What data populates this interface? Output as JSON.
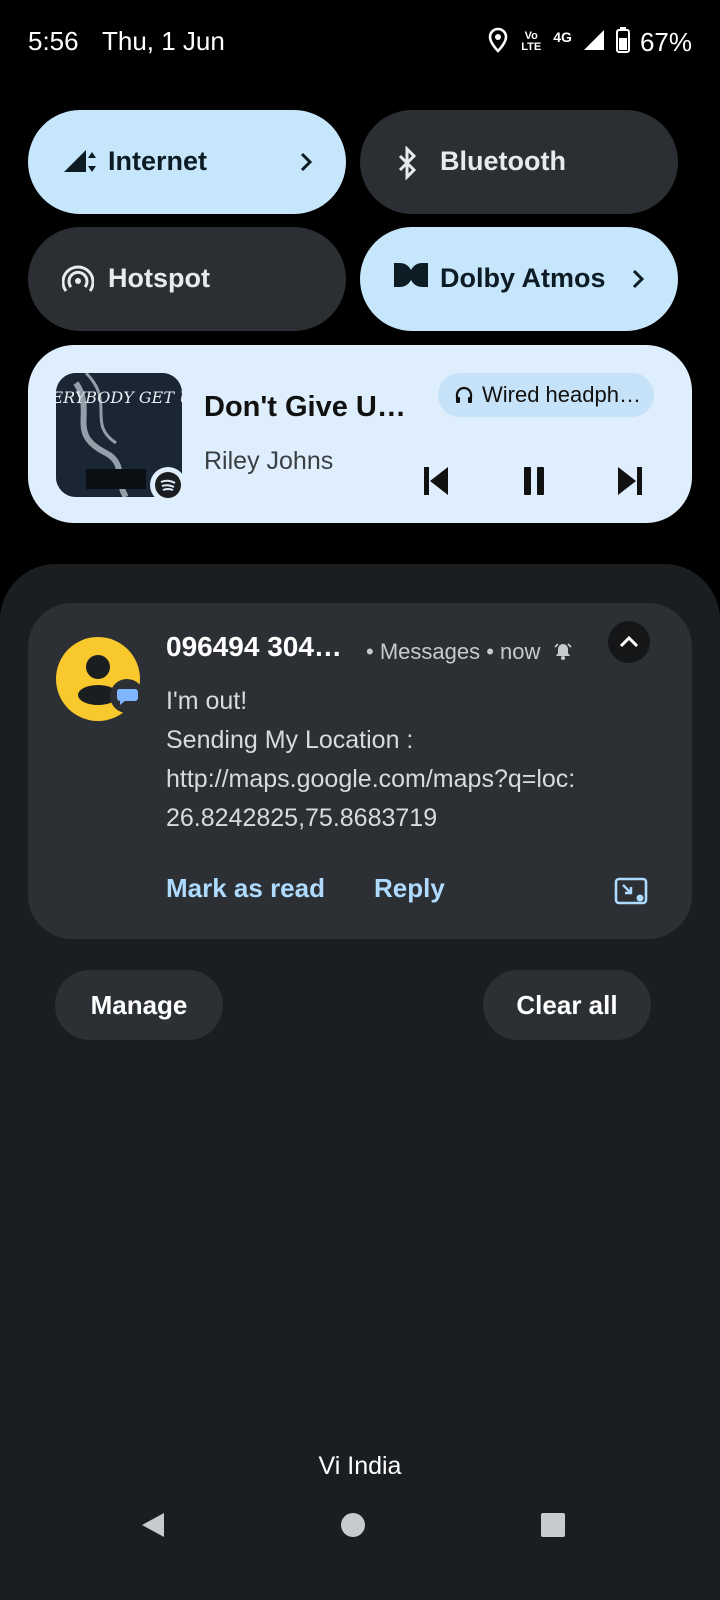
{
  "status_bar": {
    "time": "5:56",
    "date": "Thu, 1 Jun",
    "volte_top": "Vo",
    "volte_bottom": "LTE",
    "network": "4G",
    "battery": "67%",
    "battery_level": 0.67,
    "icons": [
      "location-icon",
      "volte-icon",
      "signal-icon",
      "battery-icon"
    ]
  },
  "quick_settings": {
    "tiles": [
      {
        "label": "Internet",
        "state": "on",
        "icon": "signal-data-icon"
      },
      {
        "label": "Bluetooth",
        "state": "off",
        "icon": "bluetooth-icon"
      },
      {
        "label": "Hotspot",
        "state": "off",
        "icon": "hotspot-icon"
      },
      {
        "label": "Dolby Atmos",
        "state": "on",
        "icon": "dolby-icon"
      }
    ]
  },
  "media": {
    "album_art_text": "EVERYBODY GET UP!",
    "title": "Don't Give U…",
    "artist": "Riley Johns",
    "output": "Wired headph…",
    "app_icon": "spotify-icon",
    "controls": [
      "previous-icon",
      "pause-icon",
      "next-icon"
    ]
  },
  "notification": {
    "title": "096494 304…",
    "meta": "• Messages • now",
    "body_lines": [
      "I'm out!",
      "Sending My Location :",
      "http://maps.google.com/maps?q=loc:",
      "26.8242825,75.8683719"
    ],
    "actions": [
      "Mark as read",
      "Reply"
    ]
  },
  "buttons": {
    "manage": "Manage",
    "clear_all": "Clear all"
  },
  "carrier": "Vi India",
  "colors": {
    "tile_on": "#c6e6fc",
    "tile_off": "#2b2f33",
    "accent_text": "#aedbff",
    "avatar": "#f8c82d",
    "shade": "#1b1e21"
  }
}
